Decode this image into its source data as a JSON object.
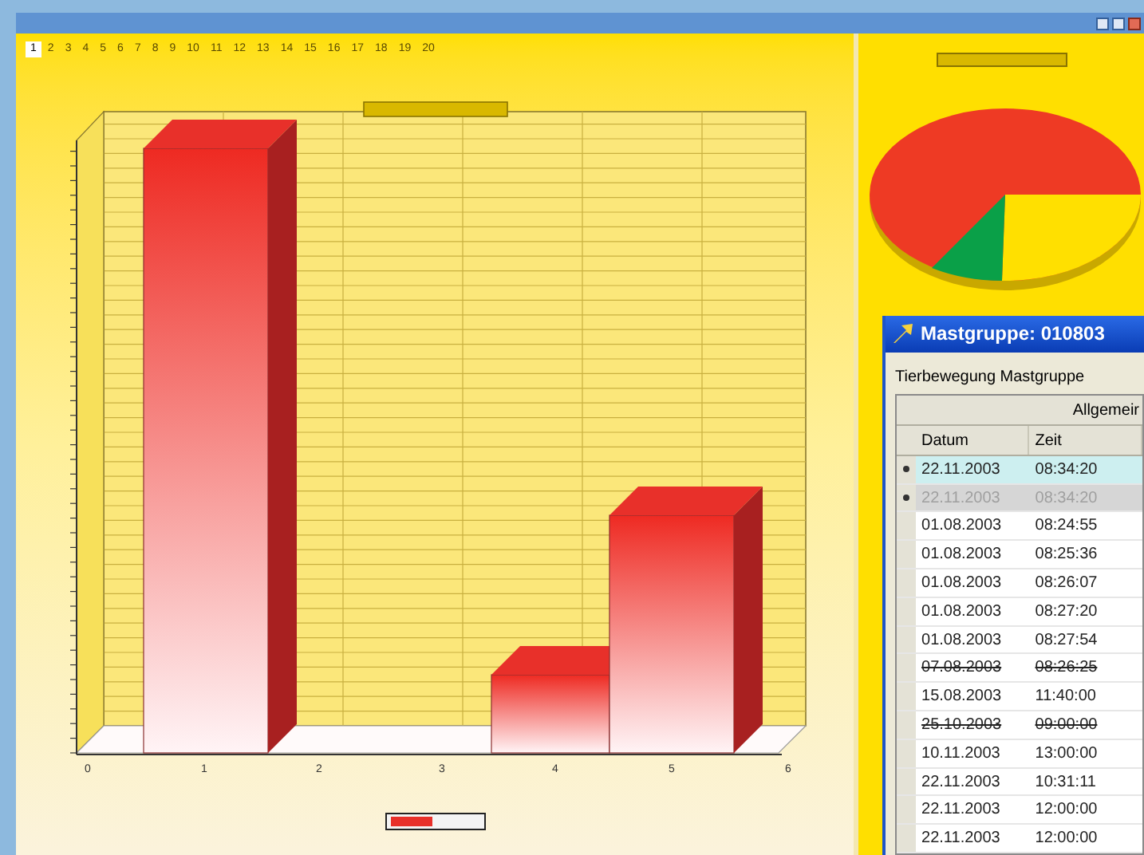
{
  "tabs": [
    {
      "label": "1",
      "selected": true
    },
    {
      "label": "2",
      "selected": false
    },
    {
      "label": "3",
      "selected": false
    },
    {
      "label": "4",
      "selected": false
    },
    {
      "label": "5",
      "selected": false
    },
    {
      "label": "6",
      "selected": false
    },
    {
      "label": "7",
      "selected": false
    },
    {
      "label": "8",
      "selected": false
    },
    {
      "label": "9",
      "selected": false
    },
    {
      "label": "10",
      "selected": false
    },
    {
      "label": "11",
      "selected": false
    },
    {
      "label": "12",
      "selected": false
    },
    {
      "label": "13",
      "selected": false
    },
    {
      "label": "14",
      "selected": false
    },
    {
      "label": "15",
      "selected": false
    },
    {
      "label": "16",
      "selected": false
    },
    {
      "label": "17",
      "selected": false
    },
    {
      "label": "18",
      "selected": false
    },
    {
      "label": "19",
      "selected": false
    },
    {
      "label": "20",
      "selected": false
    }
  ],
  "bar_chart": {
    "x_labels": [
      "0",
      "1",
      "2",
      "3",
      "4",
      "5",
      "6"
    ]
  },
  "dialog": {
    "title": "Mastgruppe: 010803",
    "section": "Tierbewegung Mastgruppe",
    "group_header": "Allgemeir",
    "columns": [
      "Datum",
      "Zeit"
    ],
    "rows": [
      {
        "cells": [
          "22.11.2003",
          "08:34:20"
        ],
        "selected": true,
        "marked": true,
        "disabled": false,
        "struck": false
      },
      {
        "cells": [
          "22.11.2003",
          "08:34:20"
        ],
        "selected": false,
        "marked": true,
        "disabled": true,
        "struck": false
      },
      {
        "cells": [
          "01.08.2003",
          "08:24:55"
        ],
        "selected": false,
        "marked": false,
        "disabled": false,
        "struck": false
      },
      {
        "cells": [
          "01.08.2003",
          "08:25:36"
        ],
        "selected": false,
        "marked": false,
        "disabled": false,
        "struck": false
      },
      {
        "cells": [
          "01.08.2003",
          "08:26:07"
        ],
        "selected": false,
        "marked": false,
        "disabled": false,
        "struck": false
      },
      {
        "cells": [
          "01.08.2003",
          "08:27:20"
        ],
        "selected": false,
        "marked": false,
        "disabled": false,
        "struck": false
      },
      {
        "cells": [
          "01.08.2003",
          "08:27:54"
        ],
        "selected": false,
        "marked": false,
        "disabled": false,
        "struck": false
      },
      {
        "cells": [
          "07.08.2003",
          "08:26:25"
        ],
        "selected": false,
        "marked": false,
        "disabled": false,
        "struck": true
      },
      {
        "cells": [
          "15.08.2003",
          "11:40:00"
        ],
        "selected": false,
        "marked": false,
        "disabled": false,
        "struck": false
      },
      {
        "cells": [
          "25.10.2003",
          "09:00:00"
        ],
        "selected": false,
        "marked": false,
        "disabled": false,
        "struck": true
      },
      {
        "cells": [
          "10.11.2003",
          "13:00:00"
        ],
        "selected": false,
        "marked": false,
        "disabled": false,
        "struck": false
      },
      {
        "cells": [
          "22.11.2003",
          "10:31:11"
        ],
        "selected": false,
        "marked": false,
        "disabled": false,
        "struck": false
      },
      {
        "cells": [
          "22.11.2003",
          "12:00:00"
        ],
        "selected": false,
        "marked": false,
        "disabled": false,
        "struck": false
      },
      {
        "cells": [
          "22.11.2003",
          "12:00:00"
        ],
        "selected": false,
        "marked": false,
        "disabled": false,
        "struck": false
      }
    ]
  }
}
